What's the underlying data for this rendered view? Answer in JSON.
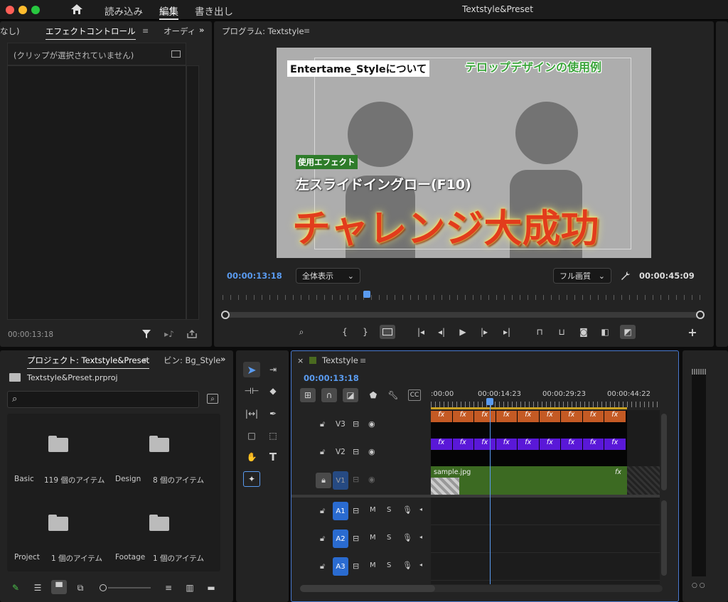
{
  "app_title": "Textstyle&Preset",
  "menu": {
    "import": "読み込み",
    "edit": "編集",
    "export": "書き出し"
  },
  "effect_panel": {
    "tab_prev": "なし)",
    "tab_effect_controls": "エフェクトコントロール",
    "tab_audio": "オーディ",
    "no_clip_text": "(クリップが選択されていません)",
    "timecode": "00:00:13:18"
  },
  "program": {
    "title": "プログラム: Textstyle",
    "current_time": "00:00:13:18",
    "duration": "00:00:45:09",
    "zoom_select": "全体表示",
    "quality_select": "フル画質",
    "overlay_title": "Entertame_Styleについて",
    "overlay_green": "テロップデザインの使用例",
    "overlay_label": "使用エフェクト",
    "overlay_subtitle": "左スライドイングロー(F10)",
    "overlay_main": "チャレンジ大成功"
  },
  "project": {
    "tab_project": "プロジェクト: Textstyle&Preset",
    "tab_bin": "ビン: Bg_Style",
    "file": "Textstyle&Preset.prproj",
    "search_placeholder": "",
    "bins": [
      {
        "name": "Basic",
        "count": "119 個のアイテム"
      },
      {
        "name": "Design",
        "count": "8 個のアイテム"
      },
      {
        "name": "Project",
        "count": "1 個のアイテム"
      },
      {
        "name": "Footage",
        "count": "1 個のアイテム"
      }
    ]
  },
  "timeline": {
    "sequence": "Textstyle",
    "timecode": "00:00:13:18",
    "ruler": [
      ":00:00",
      "00:00:14:23",
      "00:00:29:23",
      "00:00:44:22"
    ],
    "tracks": [
      {
        "label": "V3"
      },
      {
        "label": "V2"
      },
      {
        "label": "V1"
      },
      {
        "label": "A1"
      },
      {
        "label": "A2"
      },
      {
        "label": "A3"
      }
    ],
    "audio_m": "M",
    "audio_s": "S",
    "v1_clip": "sample.jpg",
    "fx_label": "fx",
    "fx_count_v3": 9,
    "fx_count_v2": 9
  },
  "colors": {
    "accent_blue": "#5a9bf0",
    "v3_clip": "#c45a24",
    "v2_clip": "#5a18d8",
    "v1_clip": "#3c6a22",
    "track_badge": "#2a6bd0"
  },
  "meter_labels": "○ ○"
}
